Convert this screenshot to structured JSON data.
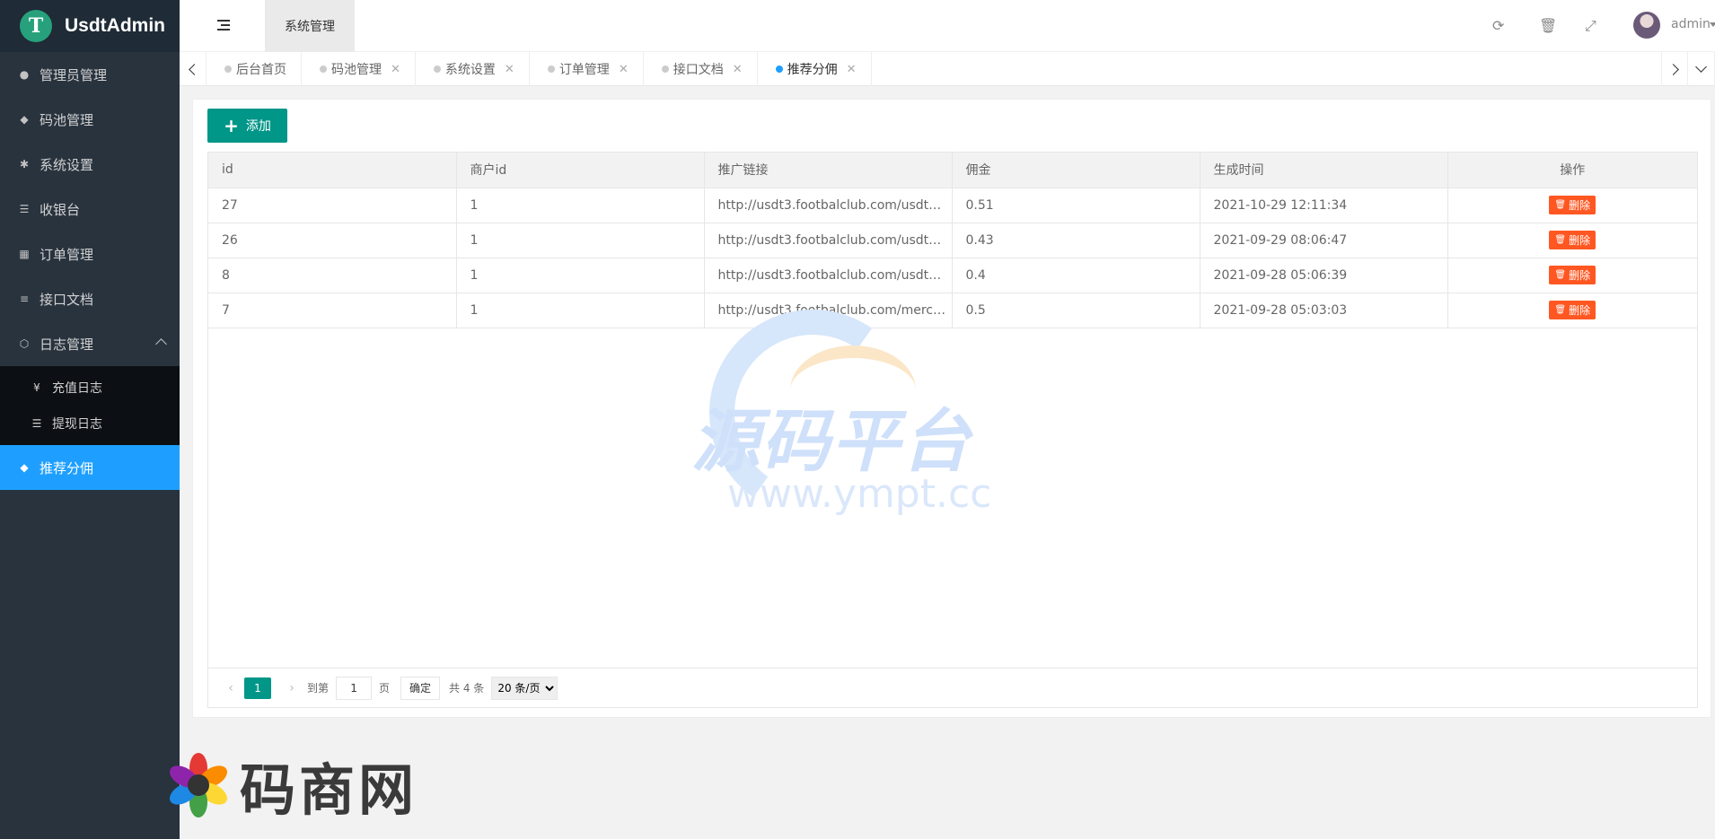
{
  "app": {
    "logo_letter": "T",
    "name": "UsdtAdmin"
  },
  "sidebar": {
    "items": [
      {
        "icon": "user-icon",
        "label": "管理员管理"
      },
      {
        "icon": "android-icon",
        "label": "码池管理"
      },
      {
        "icon": "gear-icon",
        "label": "系统设置"
      },
      {
        "icon": "list-icon",
        "label": "收银台"
      },
      {
        "icon": "calculator-icon",
        "label": "订单管理"
      },
      {
        "icon": "align-left-icon",
        "label": "接口文档"
      },
      {
        "icon": "cube-icon",
        "label": "日志管理"
      }
    ],
    "sub_items": [
      {
        "icon": "yen-icon",
        "label": "充值日志"
      },
      {
        "icon": "list-icon",
        "label": "提现日志"
      }
    ],
    "active_item": {
      "icon": "android-icon",
      "label": "推荐分佣"
    }
  },
  "header": {
    "top_tab": "系统管理",
    "user_name": "admin"
  },
  "tabs": [
    {
      "label": "后台首页",
      "closable": false,
      "active": false
    },
    {
      "label": "码池管理",
      "closable": true,
      "active": false
    },
    {
      "label": "系统设置",
      "closable": true,
      "active": false
    },
    {
      "label": "订单管理",
      "closable": true,
      "active": false
    },
    {
      "label": "接口文档",
      "closable": true,
      "active": false
    },
    {
      "label": "推荐分佣",
      "closable": true,
      "active": true
    }
  ],
  "toolbar": {
    "add_label": "添加"
  },
  "table": {
    "columns": [
      "id",
      "商户id",
      "推广链接",
      "佣金",
      "生成时间",
      "操作"
    ],
    "rows": [
      {
        "id": "27",
        "merchant_id": "1",
        "link": "http://usdt3.footbalclub.com/usdtmer…",
        "commission": "0.51",
        "created": "2021-10-29 12:11:34"
      },
      {
        "id": "26",
        "merchant_id": "1",
        "link": "http://usdt3.footbalclub.com/usdtmer…",
        "commission": "0.43",
        "created": "2021-09-29 08:06:47"
      },
      {
        "id": "8",
        "merchant_id": "1",
        "link": "http://usdt3.footbalclub.com/usdtmer…",
        "commission": "0.4",
        "created": "2021-09-28 05:06:39"
      },
      {
        "id": "7",
        "merchant_id": "1",
        "link": "http://usdt3.footbalclub.com/merchan…",
        "commission": "0.5",
        "created": "2021-09-28 05:03:03"
      }
    ],
    "delete_label": "删除"
  },
  "pager": {
    "current": "1",
    "goto_label": "到第",
    "goto_value": "1",
    "page_suffix": "页",
    "confirm_label": "确定",
    "total_label": "共 4 条",
    "page_size": "20 条/页"
  },
  "watermark": {
    "text": "源码平台",
    "url": "www.ympt.cc"
  },
  "bottom_logo": {
    "text": "码商网"
  },
  "colors": {
    "primary": "#009688",
    "accent": "#1e9fff",
    "danger": "#ff5722",
    "sidebar": "#28333e"
  }
}
